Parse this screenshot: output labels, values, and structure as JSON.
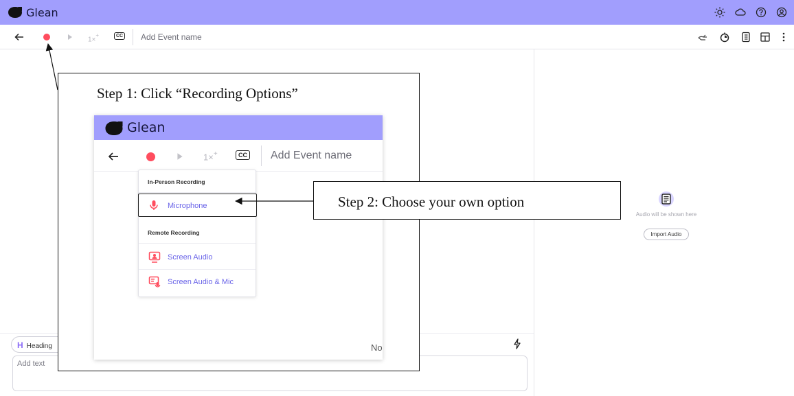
{
  "app": {
    "title": "Glean"
  },
  "top_bar": {
    "icons": [
      "sun-icon",
      "cloud-icon",
      "help-icon",
      "account-icon"
    ]
  },
  "toolbar": {
    "back_icon": "arrow-left-icon",
    "record_icon": "record-icon",
    "play_icon": "play-icon",
    "speed_label": "1×",
    "speed_sup": "+",
    "cc_label": "CC",
    "event_name_placeholder": "Add Event name",
    "right_icons": [
      "hand-icon",
      "timer-icon",
      "notebook-icon",
      "layout-icon",
      "more-vertical-icon"
    ]
  },
  "editor": {
    "heading_letter": "H",
    "heading_label": "Heading",
    "add_text_placeholder": "Add text",
    "bolt_icon": "bolt-icon"
  },
  "audio_panel": {
    "message": "Audio will be shown here",
    "import_label": "Import Audio"
  },
  "annotation": {
    "step1": "Step 1: Click “Recording Options”",
    "step2": "Step 2: Choose your own option",
    "inset": {
      "title": "Glean",
      "speed_label": "1×",
      "speed_sup": "+",
      "cc_label": "CC",
      "event_name": "Add Event name",
      "footer_text": "No",
      "menu": {
        "in_person_header": "In-Person Recording",
        "remote_header": "Remote Recording",
        "options": [
          {
            "label": "Microphone",
            "icon": "microphone-icon",
            "selected": true
          },
          {
            "label": "Screen Audio",
            "icon": "screen-audio-icon",
            "selected": false
          },
          {
            "label": "Screen Audio & Mic",
            "icon": "screen-audio-mic-icon",
            "selected": false
          }
        ]
      }
    }
  },
  "colors": {
    "brand_bar": "#a19efd",
    "record_red": "#ff4d5e",
    "option_text": "#6a64e8"
  }
}
